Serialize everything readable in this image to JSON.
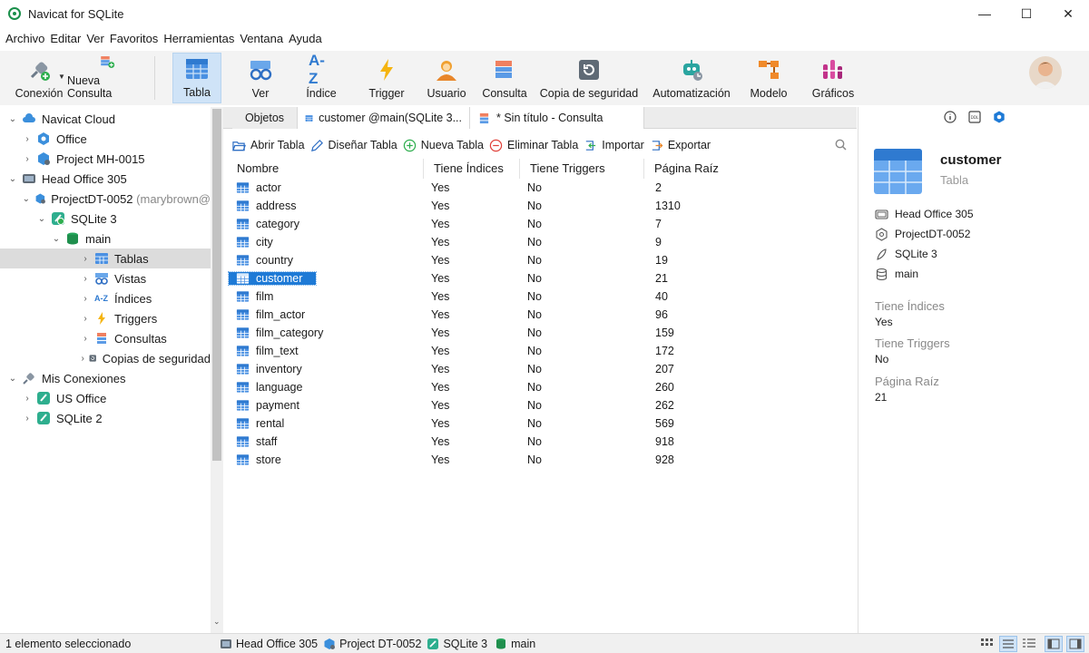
{
  "window": {
    "title": "Navicat for SQLite",
    "minimize": "—",
    "maximize": "☐",
    "close": "✕"
  },
  "menu": [
    "Archivo",
    "Editar",
    "Ver",
    "Favoritos",
    "Herramientas",
    "Ventana",
    "Ayuda"
  ],
  "toolbar": {
    "conexion": "Conexión",
    "nueva_consulta": "Nueva Consulta",
    "tabla": "Tabla",
    "ver": "Ver",
    "indice": "Índice",
    "trigger": "Trigger",
    "usuario": "Usuario",
    "consulta": "Consulta",
    "copia": "Copia de seguridad",
    "automatizacion": "Automatización",
    "modelo": "Modelo",
    "graficos": "Gráficos",
    "indice_glyph": "A-Z"
  },
  "tree": {
    "navicat_cloud": "Navicat Cloud",
    "office": "Office",
    "project_mh": "Project MH-0015",
    "head_office": "Head Office 305",
    "project_dt": "ProjectDT-0052",
    "project_dt_owner": "(marybrown@",
    "sqlite3": "SQLite 3",
    "main": "main",
    "tablas": "Tablas",
    "vistas": "Vistas",
    "indices": "Índices",
    "triggers": "Triggers",
    "consultas": "Consultas",
    "copias": "Copias de seguridad",
    "mis_conexiones": "Mis Conexiones",
    "us_office": "US Office",
    "sqlite2": "SQLite 2"
  },
  "tabs": {
    "objetos": "Objetos",
    "customer": "customer @main(SQLite 3...",
    "consulta": "* Sin título - Consulta"
  },
  "objbar": {
    "abrir": "Abrir Tabla",
    "disenar": "Diseñar Tabla",
    "nueva": "Nueva Tabla",
    "eliminar": "Eliminar Tabla",
    "importar": "Importar",
    "exportar": "Exportar"
  },
  "grid": {
    "headers": {
      "nombre": "Nombre",
      "indices": "Tiene Índices",
      "triggers": "Tiene Triggers",
      "pagina": "Página Raíz"
    },
    "rows": [
      {
        "name": "actor",
        "idx": "Yes",
        "trg": "No",
        "page": "2"
      },
      {
        "name": "address",
        "idx": "Yes",
        "trg": "No",
        "page": "1310"
      },
      {
        "name": "category",
        "idx": "Yes",
        "trg": "No",
        "page": "7"
      },
      {
        "name": "city",
        "idx": "Yes",
        "trg": "No",
        "page": "9"
      },
      {
        "name": "country",
        "idx": "Yes",
        "trg": "No",
        "page": "19"
      },
      {
        "name": "customer",
        "idx": "Yes",
        "trg": "No",
        "page": "21"
      },
      {
        "name": "film",
        "idx": "Yes",
        "trg": "No",
        "page": "40"
      },
      {
        "name": "film_actor",
        "idx": "Yes",
        "trg": "No",
        "page": "96"
      },
      {
        "name": "film_category",
        "idx": "Yes",
        "trg": "No",
        "page": "159"
      },
      {
        "name": "film_text",
        "idx": "Yes",
        "trg": "No",
        "page": "172"
      },
      {
        "name": "inventory",
        "idx": "Yes",
        "trg": "No",
        "page": "207"
      },
      {
        "name": "language",
        "idx": "Yes",
        "trg": "No",
        "page": "260"
      },
      {
        "name": "payment",
        "idx": "Yes",
        "trg": "No",
        "page": "262"
      },
      {
        "name": "rental",
        "idx": "Yes",
        "trg": "No",
        "page": "569"
      },
      {
        "name": "staff",
        "idx": "Yes",
        "trg": "No",
        "page": "918"
      },
      {
        "name": "store",
        "idx": "Yes",
        "trg": "No",
        "page": "928"
      }
    ],
    "selected": "customer"
  },
  "info": {
    "ddl_label": "DDL",
    "name": "customer",
    "type": "Tabla",
    "path": {
      "group": "Head Office 305",
      "project": "ProjectDT-0052",
      "connection": "SQLite 3",
      "schema": "main"
    },
    "tiene_indices_label": "Tiene Índices",
    "tiene_indices_value": "Yes",
    "tiene_triggers_label": "Tiene Triggers",
    "tiene_triggers_value": "No",
    "pagina_raiz_label": "Página Raíz",
    "pagina_raiz_value": "21"
  },
  "status": {
    "selection": "1 elemento seleccionado",
    "group": "Head Office 305",
    "project": "Project DT-0052",
    "connection": "SQLite 3",
    "schema": "main"
  },
  "colors": {
    "accent": "#1e7ad6",
    "toolbar_active": "#cfe3f7",
    "selection_gray": "#dcdcdc"
  }
}
